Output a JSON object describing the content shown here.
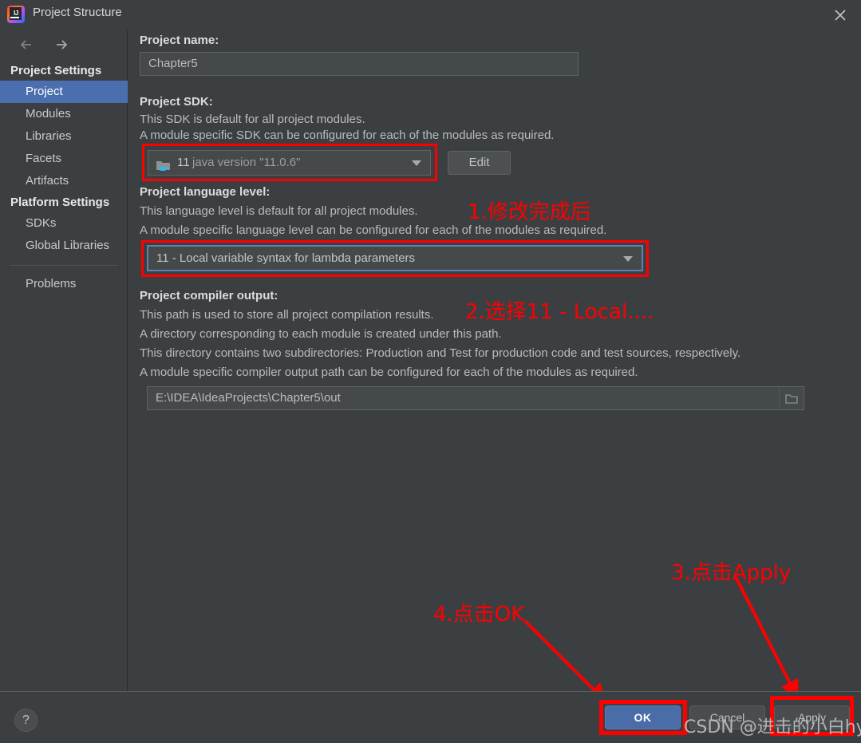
{
  "window": {
    "title": "Project Structure",
    "logo_icon": "intellij-idea-logo",
    "close_icon": "close-icon"
  },
  "nav": {
    "back_icon": "arrow-left-icon",
    "forward_icon": "arrow-right-icon"
  },
  "sidebar": {
    "groups": [
      {
        "header": "Project Settings",
        "items": [
          {
            "label": "Project",
            "selected": true
          },
          {
            "label": "Modules",
            "selected": false
          },
          {
            "label": "Libraries",
            "selected": false
          },
          {
            "label": "Facets",
            "selected": false
          },
          {
            "label": "Artifacts",
            "selected": false
          }
        ]
      },
      {
        "header": "Platform Settings",
        "items": [
          {
            "label": "SDKs",
            "selected": false
          },
          {
            "label": "Global Libraries",
            "selected": false
          }
        ]
      }
    ],
    "problems": {
      "label": "Problems"
    }
  },
  "main": {
    "project_name": {
      "label": "Project name:",
      "value": "Chapter5"
    },
    "project_sdk": {
      "label": "Project SDK:",
      "desc_line1": "This SDK is default for all project modules.",
      "desc_line2": "A module specific SDK can be configured for each of the modules as required.",
      "value_version": "11",
      "value_detail": "java version \"11.0.6\"",
      "icon": "java-sdk-folder-icon",
      "edit_button": "Edit"
    },
    "language_level": {
      "label": "Project language level:",
      "desc_line1": "This language level is default for all project modules.",
      "desc_line2": "A module specific language level can be configured for each of the modules as required.",
      "value": "11 - Local variable syntax for lambda parameters"
    },
    "compiler_output": {
      "label": "Project compiler output:",
      "desc_line1": "This path is used to store all project compilation results.",
      "desc_line2": "A directory corresponding to each module is created under this path.",
      "desc_line3": "This directory contains two subdirectories: Production and Test for production code and test sources, respectively.",
      "desc_line4": "A module specific compiler output path can be configured for each of the modules as required.",
      "value": "E:\\IDEA\\IdeaProjects\\Chapter5\\out",
      "browse_icon": "folder-browse-icon"
    }
  },
  "annotations": {
    "step1": "1.修改完成后",
    "step2": "2.选择11 - Local....",
    "step3": "3.点击Apply",
    "step4": "4.点击OK",
    "color": "#fe0000"
  },
  "footer": {
    "help_label": "?",
    "ok_label": "OK",
    "cancel_label": "Cancel",
    "apply_label": "Apply",
    "watermark": "CSDN @进击的小白hyh"
  }
}
